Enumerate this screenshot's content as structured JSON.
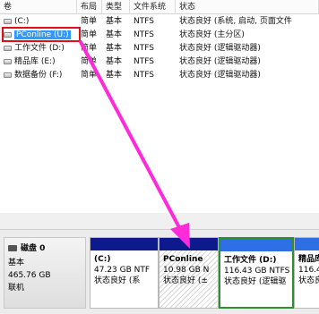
{
  "columns": [
    "卷",
    "布局",
    "类型",
    "文件系统",
    "状态"
  ],
  "volumes": [
    {
      "name": "(C:)",
      "layout": "简单",
      "type": "基本",
      "fs": "NTFS",
      "status": "状态良好 (系统, 启动, 页面文件"
    },
    {
      "name": "PConline (U:)",
      "layout": "简单",
      "type": "基本",
      "fs": "NTFS",
      "status": "状态良好 (主分区)"
    },
    {
      "name": "工作文件 (D:)",
      "layout": "简单",
      "type": "基本",
      "fs": "NTFS",
      "status": "状态良好 (逻辑驱动器)"
    },
    {
      "name": "精品库 (E:)",
      "layout": "简单",
      "type": "基本",
      "fs": "NTFS",
      "status": "状态良好 (逻辑驱动器)"
    },
    {
      "name": "数据备份 (F:)",
      "layout": "简单",
      "type": "基本",
      "fs": "NTFS",
      "status": "状态良好 (逻辑驱动器)"
    }
  ],
  "disk": {
    "name": "磁盘 0",
    "type": "基本",
    "size": "465.76 GB",
    "state": "联机"
  },
  "partitions": [
    {
      "name": "(C:)",
      "size": "47.23 GB NTF",
      "status": "状态良好 (系"
    },
    {
      "name": "PConline",
      "size": "10.98 GB N",
      "status": "状态良好 (±"
    },
    {
      "name": "工作文件 (D:)",
      "size": "116.43 GB NTFS",
      "status": "状态良好 (逻辑驱"
    },
    {
      "name": "精品库",
      "size": "116.4",
      "status": "状态良"
    }
  ],
  "colors": {
    "primary_bar": "#0c1a8e",
    "logical_bar": "#2f6fe6",
    "selection": "#3399ff",
    "highlight_box": "#e0101a",
    "arrow": "#ff2bd9"
  }
}
